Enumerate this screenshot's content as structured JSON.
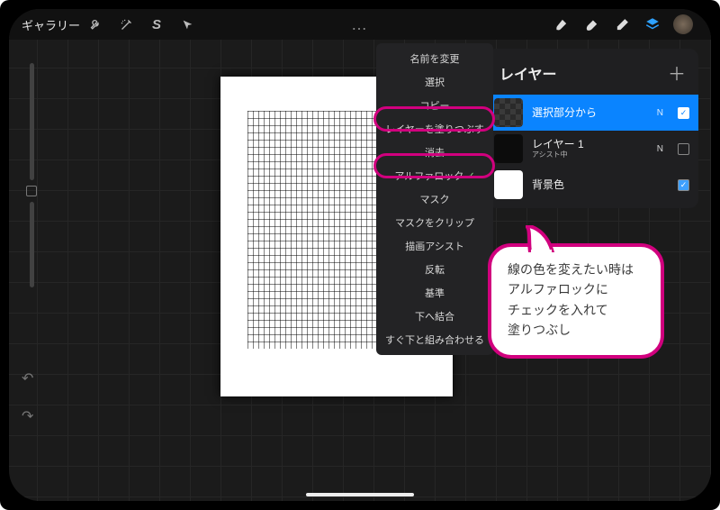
{
  "topbar": {
    "gallery_label": "ギャラリー",
    "icons": {
      "wrench": "wrench-icon",
      "wand": "magic-wand-icon",
      "lasso": "lasso-s-icon",
      "pointer": "pointer-icon",
      "more": "…",
      "brush": "brush-icon",
      "smudge": "smudge-icon",
      "eraser": "eraser-icon",
      "layers": "layers-icon",
      "color": "color-disc"
    }
  },
  "context_menu": {
    "items": [
      "名前を変更",
      "選択",
      "コピー",
      "レイヤーを塗りつぶす",
      "消去",
      "アルファロック",
      "マスク",
      "マスクをクリップ",
      "描画アシスト",
      "反転",
      "基準",
      "下へ結合",
      "すぐ下と組み合わせる"
    ],
    "alpha_lock_checked": true,
    "highlighted": [
      "レイヤーを塗りつぶす",
      "アルファロック"
    ]
  },
  "layers_panel": {
    "title": "レイヤー",
    "rows": [
      {
        "name": "選択部分から",
        "sub": "",
        "mode": "N",
        "checked": true,
        "thumb": "checker",
        "active": true
      },
      {
        "name": "レイヤー 1",
        "sub": "アシスト中",
        "mode": "N",
        "checked": false,
        "thumb": "dark",
        "active": false
      },
      {
        "name": "背景色",
        "sub": "",
        "mode": "",
        "checked": true,
        "thumb": "white",
        "active": false
      }
    ]
  },
  "annotation": {
    "text": "線の色を変えたい時は\nアルファロックに\nチェックを入れて\n塗りつぶし"
  },
  "colors": {
    "accent_pink": "#d1007e",
    "accent_blue": "#0a84ff"
  }
}
